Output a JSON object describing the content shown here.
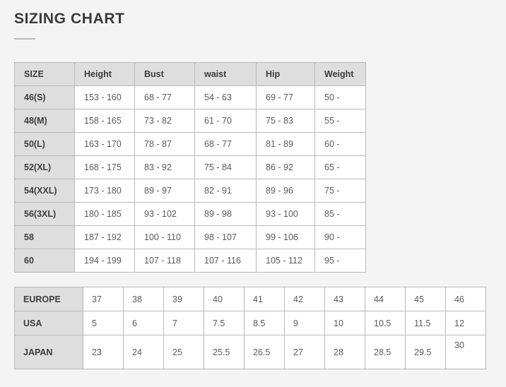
{
  "page": {
    "title": "SIZING CHART",
    "background_color": "#f4f4f4",
    "accent_divider_color": "#b8b8b8"
  },
  "measurements_table": {
    "name": "body-measurements",
    "headers": [
      "SIZE",
      "Height",
      "Bust",
      "waist",
      "Hip",
      "Weight"
    ],
    "rows": [
      {
        "size": "46(S)",
        "height": "153 - 160",
        "bust": "68 - 77",
        "waist": "54 - 63",
        "hip": "69 - 77",
        "weight": "50 -"
      },
      {
        "size": "48(M)",
        "height": "158 - 165",
        "bust": "73 - 82",
        "waist": "61 - 70",
        "hip": "75 - 83",
        "weight": "55 -"
      },
      {
        "size": "50(L)",
        "height": "163 - 170",
        "bust": "78 - 87",
        "waist": "68 - 77",
        "hip": "81 - 89",
        "weight": "60 -"
      },
      {
        "size": "52(XL)",
        "height": "168 - 175",
        "bust": "83 - 92",
        "waist": "75 - 84",
        "hip": "86 - 92",
        "weight": "65 -"
      },
      {
        "size": "54(XXL)",
        "height": "173 - 180",
        "bust": "89 - 97",
        "waist": "82 - 91",
        "hip": "89 - 96",
        "weight": "75 -"
      },
      {
        "size": "56(3XL)",
        "height": "180 - 185",
        "bust": "93 - 102",
        "waist": "89 - 98",
        "hip": "93 - 100",
        "weight": "85 -"
      },
      {
        "size": "58",
        "height": "187 - 192",
        "bust": "100 - 110",
        "waist": "98 - 107",
        "hip": "99 - 106",
        "weight": "90 -"
      },
      {
        "size": "60",
        "height": "194 - 199",
        "bust": "107 - 118",
        "waist": "107 - 116",
        "hip": "105 - 112",
        "weight": "95 -"
      }
    ]
  },
  "shoesize_table": {
    "name": "shoe-size-conversion",
    "row_labels": [
      "EUROPE",
      "USA",
      "JAPAN"
    ],
    "europe": [
      "37",
      "38",
      "39",
      "40",
      "41",
      "42",
      "43",
      "44",
      "45",
      "46"
    ],
    "usa": [
      "5",
      "6",
      "7",
      "7.5",
      "8.5",
      "9",
      "10",
      "10.5",
      "11.5",
      "12"
    ],
    "japan": [
      "23",
      "24",
      "25",
      "25.5",
      "26.5",
      "27",
      "28",
      "28.5",
      "29.5",
      "30"
    ]
  }
}
